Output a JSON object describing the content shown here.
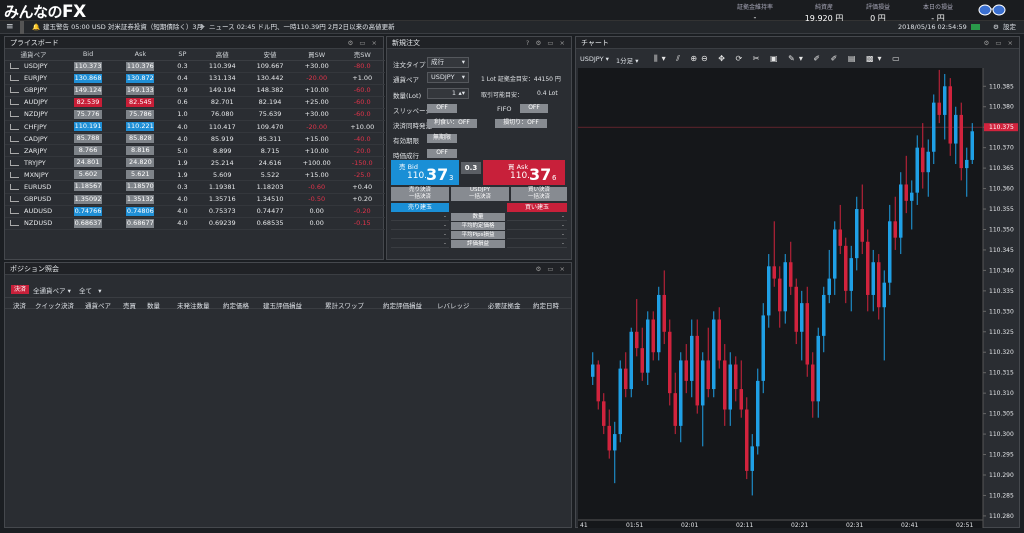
{
  "app": {
    "logo_prefix": "みんなの",
    "logo_fx": "FX"
  },
  "account": [
    {
      "label": "証拠金維持率",
      "value": "-"
    },
    {
      "label": "純資産",
      "value": "19,920 円"
    },
    {
      "label": "評価損益",
      "value": "0 円"
    },
    {
      "label": "本日の損益",
      "value": "- 円"
    }
  ],
  "news": {
    "alert": "建玉警告 05:00 USD 対米証券投資（短期債除く）3月",
    "headline": "ニュース 02:45 ドル円、一時110.39円 2月2日以来の高値更新",
    "datetime": "2018/05/16 02:54:59",
    "settings": "設定"
  },
  "price_board": {
    "title": "プライスボード",
    "headers": [
      "通貨ペア",
      "Bid",
      "Ask",
      "SP",
      "高値",
      "安値",
      "買SW",
      "売SW"
    ],
    "rows": [
      [
        "USDJPY",
        "110.373",
        "110.376",
        "0.3",
        "110.394",
        "109.667",
        "+30.00",
        "-80.0",
        "n",
        "n"
      ],
      [
        "EURJPY",
        "130.868",
        "130.872",
        "0.4",
        "131.134",
        "130.442",
        "-20.00",
        "+1.00",
        "u",
        "u"
      ],
      [
        "GBPJPY",
        "149.124",
        "149.133",
        "0.9",
        "149.194",
        "148.382",
        "+10.00",
        "-60.0",
        "n",
        "n"
      ],
      [
        "AUDJPY",
        "82.539",
        "82.545",
        "0.6",
        "82.701",
        "82.194",
        "+25.00",
        "-60.0",
        "d",
        "d"
      ],
      [
        "NZDJPY",
        "75.776",
        "75.786",
        "1.0",
        "76.080",
        "75.639",
        "+30.00",
        "-60.0",
        "n",
        "n"
      ],
      [
        "CHFJPY",
        "110.191",
        "110.221",
        "4.0",
        "110.417",
        "109.470",
        "-20.00",
        "+10.00",
        "u",
        "u"
      ],
      [
        "CADJPY",
        "85.788",
        "85.828",
        "4.0",
        "85.919",
        "85.311",
        "+15.00",
        "-40.0",
        "n",
        "n"
      ],
      [
        "ZARJPY",
        "8.766",
        "8.816",
        "5.0",
        "8.899",
        "8.715",
        "+10.00",
        "-20.0",
        "n",
        "n"
      ],
      [
        "TRYJPY",
        "24.801",
        "24.820",
        "1.9",
        "25.214",
        "24.616",
        "+100.00",
        "-150.0",
        "n",
        "n"
      ],
      [
        "MXNJPY",
        "5.602",
        "5.621",
        "1.9",
        "5.609",
        "5.522",
        "+15.00",
        "-25.0",
        "n",
        "n"
      ],
      [
        "EURUSD",
        "1.18567",
        "1.18570",
        "0.3",
        "1.19381",
        "1.18203",
        "-0.60",
        "+0.40",
        "n",
        "n"
      ],
      [
        "GBPUSD",
        "1.35092",
        "1.35132",
        "4.0",
        "1.35716",
        "1.34510",
        "-0.50",
        "+0.20",
        "n",
        "n"
      ],
      [
        "AUDUSD",
        "0.74766",
        "0.74806",
        "4.0",
        "0.75373",
        "0.74477",
        "0.00",
        "-0.20",
        "u",
        "u"
      ],
      [
        "NZDUSD",
        "0.68637",
        "0.68677",
        "4.0",
        "0.69239",
        "0.68535",
        "0.00",
        "-0.15",
        "n",
        "n"
      ]
    ]
  },
  "order": {
    "title": "新規注文",
    "type_label": "注文タイプ",
    "type_value": "成行",
    "pair_label": "通貨ペア",
    "pair_value": "USDJPY",
    "margin_note": "1 Lot 証拠金目安：44150 円",
    "qty_label": "数量(Lot)",
    "qty_value": "1",
    "avail": "取引可能目安：",
    "avail_value": "0.4 Lot",
    "slip_label": "スリッページ",
    "slip_value": "OFF",
    "fifo_label": "FIFO",
    "fifo_value": "OFF",
    "settle_label": "決済同時発注",
    "limit": "利食い：OFF",
    "stop": "損切り：OFF",
    "expiry_label": "有効期限",
    "expiry_value": "無期限",
    "timed_label": "時価成行",
    "timed_value": "OFF",
    "sell_label": "売 Bid",
    "sell_big": "110.",
    "sell_pips": "37",
    "sell_frac": "3",
    "spread": "0.3",
    "buy_label": "買 Ask",
    "buy_big": "110.",
    "buy_pips": "37",
    "buy_frac": "6",
    "sell_settle": "売り決済",
    "sell_settle2": "一括決済",
    "mid_pair": "USDJPY",
    "mid_sub": "一括決済",
    "buy_settle": "買い決済",
    "buy_settle2": "一括決済",
    "sell_pos": "売り建玉",
    "buy_pos": "買い建玉",
    "rows": [
      "数量",
      "平均約定価格",
      "平均Pips損益",
      "評価損益"
    ]
  },
  "position": {
    "title": "ポジション照会",
    "settle_btn": "決済",
    "filter1": "全通貨ペア",
    "filter2": "全て",
    "headers": [
      "決済",
      "クイック決済",
      "通貨ペア",
      "売買",
      "数量",
      "未発注数量",
      "約定価格",
      "建玉評価損益",
      "累計スワップ",
      "約定評価損益",
      "レバレッジ",
      "必要証拠金",
      "約定日時"
    ]
  },
  "chart": {
    "title": "チャート",
    "pair": "USDJPY",
    "interval": "1分足",
    "current": "110.375",
    "y_labels": [
      "110.385",
      "110.380",
      "110.375",
      "110.370",
      "110.365",
      "110.360",
      "110.355",
      "110.350",
      "110.345",
      "110.340",
      "110.335",
      "110.330",
      "110.325",
      "110.320",
      "110.315",
      "110.310",
      "110.305",
      "110.300",
      "110.295",
      "110.290",
      "110.285",
      "110.280"
    ],
    "x_labels": [
      "41",
      "01:51",
      "02:01",
      "02:11",
      "02:21",
      "02:31",
      "02:41",
      "02:51"
    ]
  },
  "chart_data": {
    "type": "candlestick",
    "ylim": [
      110.279,
      110.388
    ],
    "candles": [
      [
        110.314,
        110.32,
        110.312,
        110.317
      ],
      [
        110.317,
        110.318,
        110.306,
        110.308
      ],
      [
        110.308,
        110.31,
        110.3,
        110.302
      ],
      [
        110.302,
        110.306,
        110.294,
        110.296
      ],
      [
        110.296,
        110.303,
        110.288,
        110.3
      ],
      [
        110.3,
        110.318,
        110.298,
        110.316
      ],
      [
        110.316,
        110.32,
        110.309,
        110.311
      ],
      [
        110.311,
        110.326,
        110.309,
        110.325
      ],
      [
        110.325,
        110.333,
        110.319,
        110.321
      ],
      [
        110.321,
        110.326,
        110.313,
        110.315
      ],
      [
        110.315,
        110.33,
        110.312,
        110.328
      ],
      [
        110.328,
        110.33,
        110.318,
        110.32
      ],
      [
        110.32,
        110.336,
        110.318,
        110.334
      ],
      [
        110.334,
        110.34,
        110.322,
        110.325
      ],
      [
        110.325,
        110.328,
        110.307,
        110.31
      ],
      [
        110.31,
        110.315,
        110.3,
        110.302
      ],
      [
        110.302,
        110.32,
        110.298,
        110.318
      ],
      [
        110.318,
        110.322,
        110.31,
        110.313
      ],
      [
        110.313,
        110.328,
        110.309,
        110.324
      ],
      [
        110.324,
        110.328,
        110.305,
        110.307
      ],
      [
        110.307,
        110.32,
        110.297,
        110.318
      ],
      [
        110.318,
        110.326,
        110.309,
        110.311
      ],
      [
        110.311,
        110.33,
        110.309,
        110.328
      ],
      [
        110.328,
        110.331,
        110.316,
        110.318
      ],
      [
        110.318,
        110.322,
        110.302,
        110.306
      ],
      [
        110.306,
        110.32,
        110.302,
        110.317
      ],
      [
        110.317,
        110.319,
        110.308,
        110.311
      ],
      [
        110.311,
        110.318,
        110.304,
        110.306
      ],
      [
        110.306,
        110.309,
        110.289,
        110.291
      ],
      [
        110.291,
        110.3,
        110.285,
        110.297
      ],
      [
        110.297,
        110.316,
        110.295,
        110.313
      ],
      [
        110.313,
        110.332,
        110.31,
        110.329
      ],
      [
        110.329,
        110.344,
        110.326,
        110.341
      ],
      [
        110.341,
        110.352,
        110.336,
        110.338
      ],
      [
        110.338,
        110.341,
        110.326,
        110.33
      ],
      [
        110.33,
        110.344,
        110.327,
        110.342
      ],
      [
        110.342,
        110.347,
        110.334,
        110.336
      ],
      [
        110.336,
        110.338,
        110.322,
        110.325
      ],
      [
        110.325,
        110.335,
        110.318,
        110.332
      ],
      [
        110.332,
        110.336,
        110.314,
        110.317
      ],
      [
        110.317,
        110.32,
        110.304,
        110.308
      ],
      [
        110.308,
        110.326,
        110.304,
        110.324
      ],
      [
        110.324,
        110.336,
        110.32,
        110.334
      ],
      [
        110.334,
        110.345,
        110.332,
        110.338
      ],
      [
        110.338,
        110.352,
        110.334,
        110.35
      ],
      [
        110.35,
        110.356,
        110.344,
        110.346
      ],
      [
        110.346,
        110.348,
        110.332,
        110.335
      ],
      [
        110.335,
        110.346,
        110.33,
        110.343
      ],
      [
        110.343,
        110.358,
        110.34,
        110.355
      ],
      [
        110.355,
        110.361,
        110.344,
        110.347
      ],
      [
        110.347,
        110.35,
        110.33,
        110.334
      ],
      [
        110.334,
        110.345,
        110.33,
        110.342
      ],
      [
        110.342,
        110.344,
        110.328,
        110.331
      ],
      [
        110.331,
        110.34,
        110.318,
        110.337
      ],
      [
        110.337,
        110.356,
        110.334,
        110.352
      ],
      [
        110.352,
        110.358,
        110.345,
        110.348
      ],
      [
        110.348,
        110.364,
        110.344,
        110.361
      ],
      [
        110.361,
        110.368,
        110.354,
        110.357
      ],
      [
        110.357,
        110.362,
        110.35,
        110.359
      ],
      [
        110.359,
        110.373,
        110.356,
        110.37
      ],
      [
        110.37,
        110.376,
        110.36,
        110.364
      ],
      [
        110.364,
        110.372,
        110.358,
        110.369
      ],
      [
        110.369,
        110.383,
        110.366,
        110.381
      ],
      [
        110.381,
        110.389,
        110.376,
        110.378
      ],
      [
        110.378,
        110.388,
        110.372,
        110.385
      ],
      [
        110.385,
        110.387,
        110.368,
        110.371
      ],
      [
        110.371,
        110.38,
        110.366,
        110.378
      ],
      [
        110.378,
        110.381,
        110.362,
        110.365
      ],
      [
        110.365,
        110.37,
        110.358,
        110.367
      ],
      [
        110.367,
        110.376,
        110.366,
        110.374
      ]
    ]
  }
}
